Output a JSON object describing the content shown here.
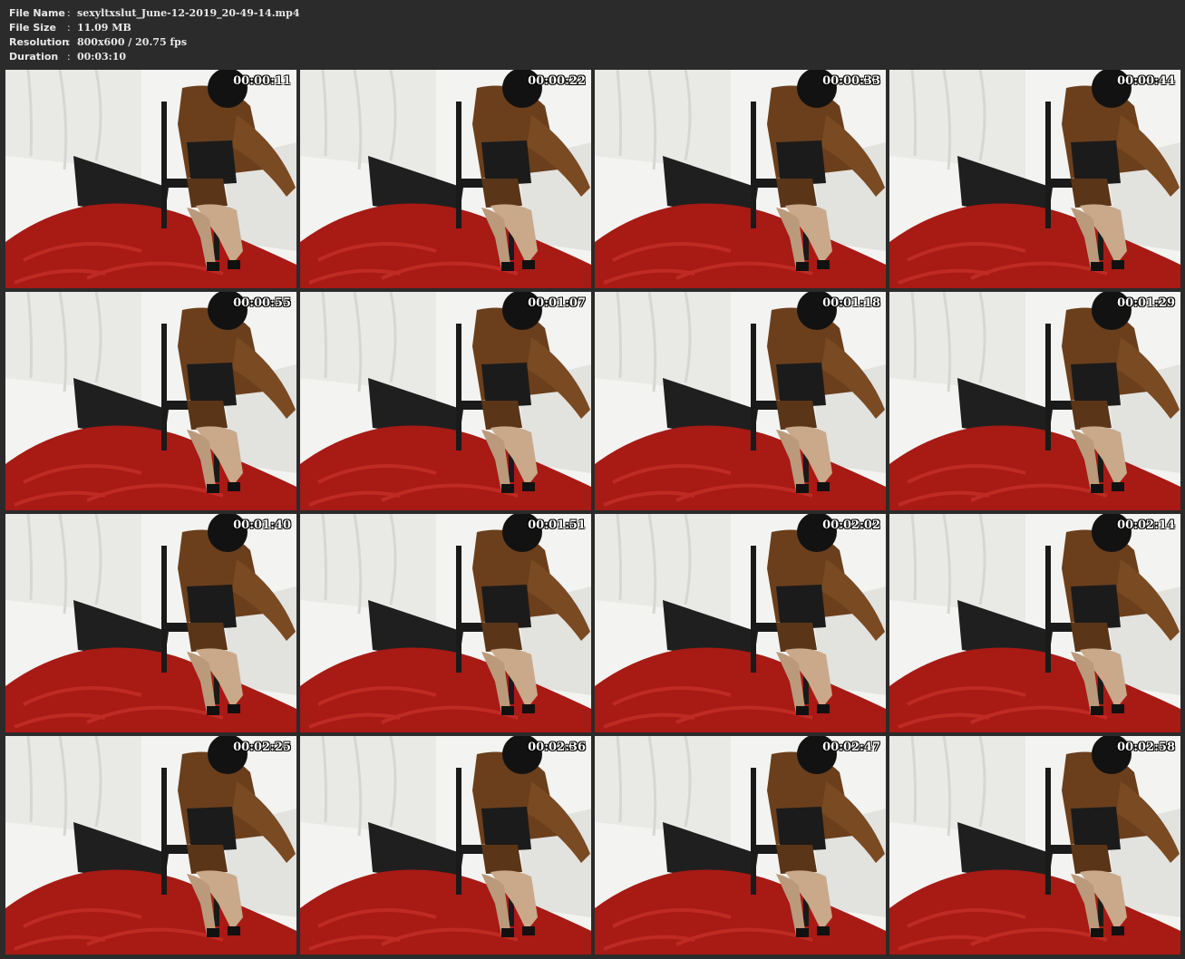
{
  "header": {
    "file_name": {
      "key": "File Name",
      "value": "sexyltxslut_June-12-2019_20-49-14.mp4"
    },
    "file_size": {
      "key": "File Size",
      "value": "11.09 MB"
    },
    "resolution": {
      "key": "Resolution",
      "value": "800x600 / 20.75 fps"
    },
    "duration": {
      "key": "Duration",
      "value": "00:03:10"
    }
  },
  "separator": ":",
  "thumbnails": [
    {
      "timestamp": "00:00:11"
    },
    {
      "timestamp": "00:00:22"
    },
    {
      "timestamp": "00:00:33"
    },
    {
      "timestamp": "00:00:44"
    },
    {
      "timestamp": "00:00:55"
    },
    {
      "timestamp": "00:01:07"
    },
    {
      "timestamp": "00:01:18"
    },
    {
      "timestamp": "00:01:29"
    },
    {
      "timestamp": "00:01:40"
    },
    {
      "timestamp": "00:01:51"
    },
    {
      "timestamp": "00:02:02"
    },
    {
      "timestamp": "00:02:14"
    },
    {
      "timestamp": "00:02:25"
    },
    {
      "timestamp": "00:02:36"
    },
    {
      "timestamp": "00:02:47"
    },
    {
      "timestamp": "00:02:58"
    }
  ],
  "colors": {
    "background": "#2b2b2b",
    "header_text": "#e8e8e8",
    "backdrop": "#f3f3f1",
    "floor_red": "#a81a14",
    "jacket_brown": "#6b3f1c",
    "mask_black": "#121212",
    "leg_tan": "#c9a98a"
  }
}
